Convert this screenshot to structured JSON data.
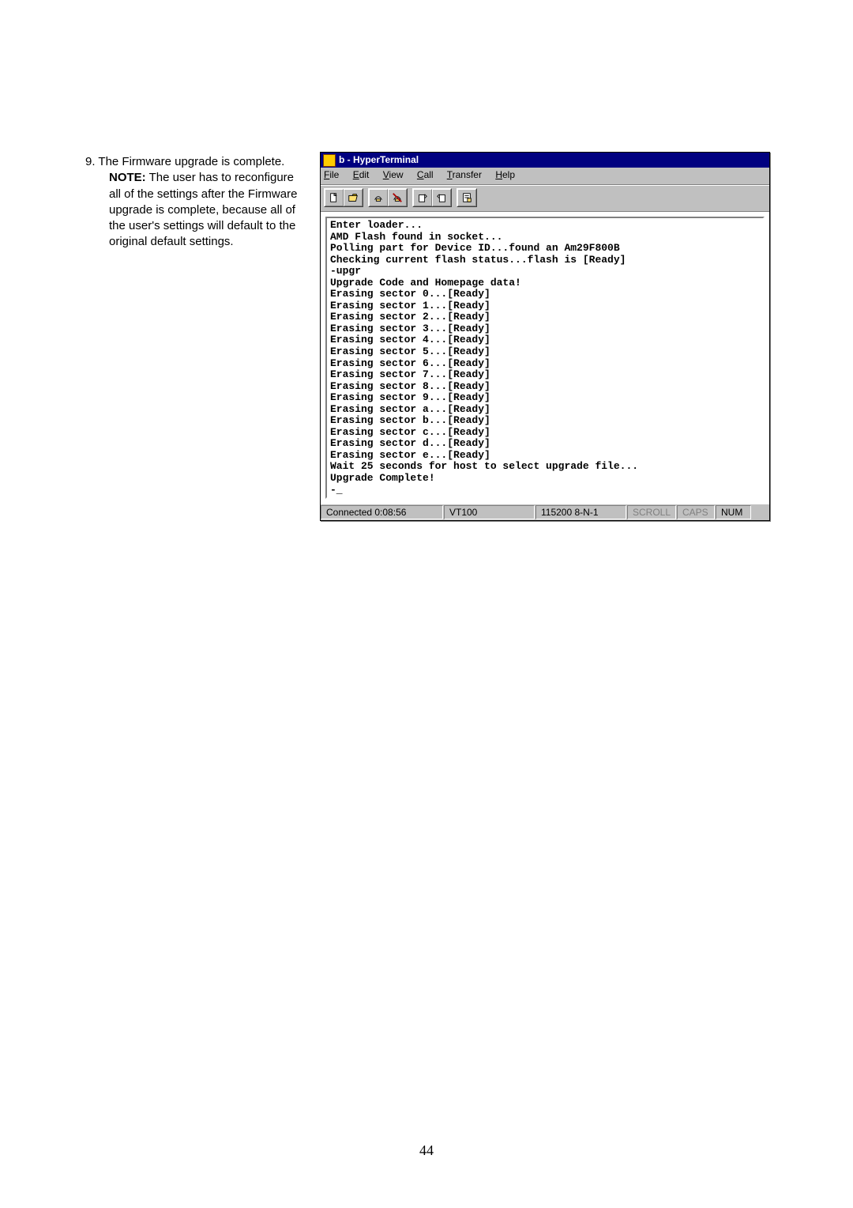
{
  "left": {
    "step_number": "9.",
    "step_text": "The Firmware upgrade is complete.",
    "note_lead": "NOTE:",
    "note_text": "  The user has to reconfigure all of the settings after the Firmware upgrade is complete, because all of the user's settings will default to the original default settings."
  },
  "window": {
    "title": "b - HyperTerminal",
    "menu": {
      "file": "File",
      "edit": "Edit",
      "view": "View",
      "call": "Call",
      "transfer": "Transfer",
      "help": "Help"
    },
    "console_text": "Enter loader...\nAMD Flash found in socket...\nPolling part for Device ID...found an Am29F800B\nChecking current flash status...flash is [Ready]\n-upgr\nUpgrade Code and Homepage data!\nErasing sector 0...[Ready]\nErasing sector 1...[Ready]\nErasing sector 2...[Ready]\nErasing sector 3...[Ready]\nErasing sector 4...[Ready]\nErasing sector 5...[Ready]\nErasing sector 6...[Ready]\nErasing sector 7...[Ready]\nErasing sector 8...[Ready]\nErasing sector 9...[Ready]\nErasing sector a...[Ready]\nErasing sector b...[Ready]\nErasing sector c...[Ready]\nErasing sector d...[Ready]\nErasing sector e...[Ready]\nWait 25 seconds for host to select upgrade file...\nUpgrade Complete!\n-_",
    "status": {
      "connected": "Connected 0:08:56",
      "vt": "VT100",
      "baud": "115200 8-N-1",
      "scroll": "SCROLL",
      "caps": "CAPS",
      "num": "NUM"
    }
  },
  "page_number": "44"
}
